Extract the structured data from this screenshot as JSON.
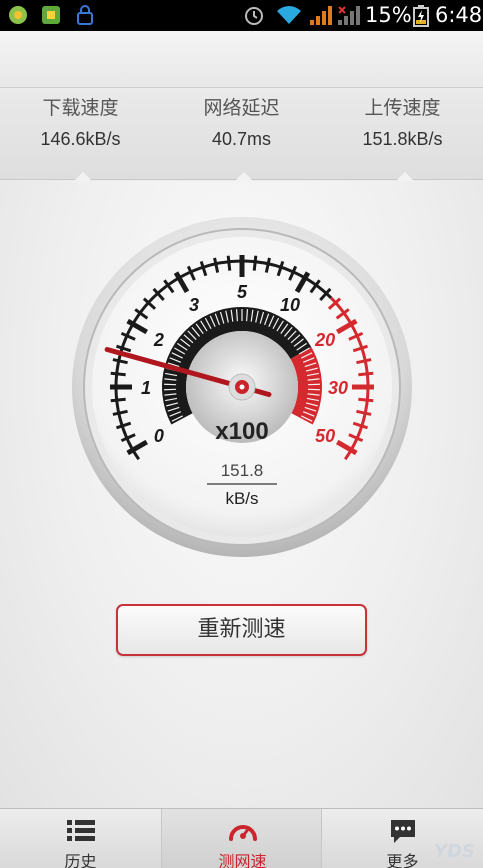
{
  "status_bar": {
    "battery_percent": "15%",
    "time": "6:48"
  },
  "stats": [
    {
      "label": "下载速度",
      "value": "146.6kB/s"
    },
    {
      "label": "网络延迟",
      "value": "40.7ms"
    },
    {
      "label": "上传速度",
      "value": "151.8kB/s"
    }
  ],
  "gauge": {
    "multiplier": "x100",
    "speed_value": "151.8",
    "speed_unit": "kB/s",
    "scale_labels": [
      "0",
      "1",
      "2",
      "3",
      "5",
      "10",
      "20",
      "30",
      "50"
    ],
    "needle_value": 1.518,
    "accent_color": "#d42a2f"
  },
  "actions": {
    "retest_label": "重新测速"
  },
  "bottom_nav": [
    {
      "label": "历史",
      "icon": "list-icon"
    },
    {
      "label": "测网速",
      "icon": "speedometer-icon"
    },
    {
      "label": "更多",
      "icon": "chat-dots-icon"
    }
  ],
  "watermark": "YDS"
}
